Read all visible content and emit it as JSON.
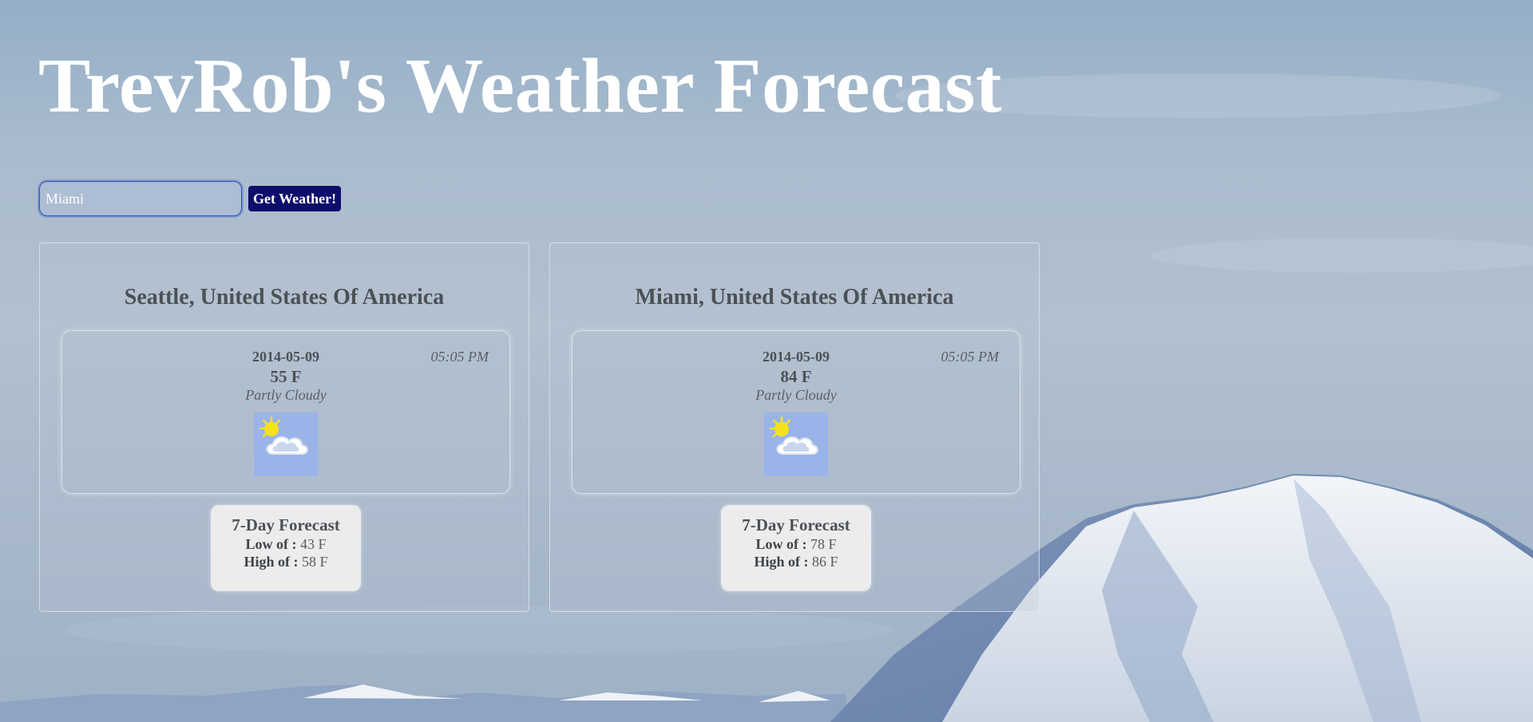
{
  "page": {
    "title": "TrevRob's Weather Forecast"
  },
  "search": {
    "value": "Miami",
    "button_label": "Get Weather!"
  },
  "cards": [
    {
      "city": "Seattle, United States Of America",
      "date": "2014-05-09",
      "time": "05:05 PM",
      "temp": "55 F",
      "condition": "Partly Cloudy",
      "icon": "partly-cloudy-icon",
      "forecast": {
        "title": "7-Day Forecast",
        "low_label": "Low of :",
        "low_value": "43 F",
        "high_label": "High of :",
        "high_value": "58 F"
      }
    },
    {
      "city": "Miami, United States Of America",
      "date": "2014-05-09",
      "time": "05:05 PM",
      "temp": "84 F",
      "condition": "Partly Cloudy",
      "icon": "partly-cloudy-icon",
      "forecast": {
        "title": "7-Day Forecast",
        "low_label": "Low of :",
        "low_value": "78 F",
        "high_label": "High of :",
        "high_value": "86 F"
      }
    }
  ],
  "colors": {
    "button_bg": "#0d0d6b",
    "title_color": "#ffffff",
    "icon_bg": "#9ab4ea",
    "sun": "#f5e21a",
    "forecast_bg": "#ececec"
  }
}
